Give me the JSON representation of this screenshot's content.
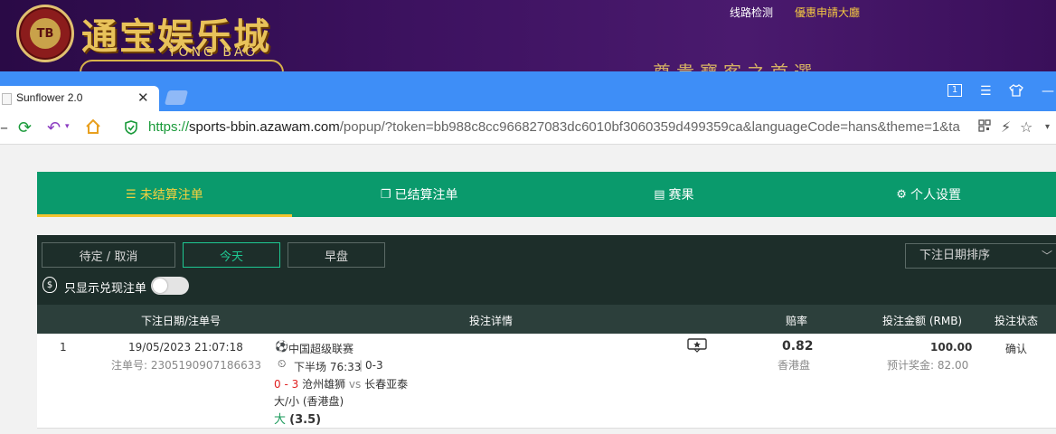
{
  "banner": {
    "chip_text": "TB",
    "brand_cn": "通宝娱乐城",
    "brand_en": "TONG BAO",
    "links": [
      "线路检测",
      "優惠申請大廳"
    ],
    "slogan": "尊貴寶客之首選"
  },
  "browser": {
    "tab_title": "Sunflower 2.0",
    "tab_count": "1",
    "url_scheme": "https://",
    "url_host": "sports-bbin.azawam.com",
    "url_rest": "/popup/?token=bb988c8cc966827083dc6010bf3060359d499359ca&languageCode=hans&theme=1&ta"
  },
  "nav": {
    "tabs": [
      {
        "label": "未结算注单",
        "icon": "unsettled-icon",
        "active": true
      },
      {
        "label": "已结算注单",
        "icon": "settled-icon",
        "active": false
      },
      {
        "label": "赛果",
        "icon": "results-icon",
        "active": false
      },
      {
        "label": "个人设置",
        "icon": "gear-icon",
        "active": false
      }
    ]
  },
  "filters": {
    "buttons": [
      {
        "label": "待定 / 取消",
        "active": false
      },
      {
        "label": "今天",
        "active": true
      },
      {
        "label": "早盘",
        "active": false
      }
    ],
    "sort_label": "下注日期排序",
    "cashout_label": "只显示兑现注单",
    "cashout_on": false
  },
  "table": {
    "headers": {
      "date": "下注日期/注单号",
      "detail": "投注详情",
      "odds": "赔率",
      "amount": "投注金额 (RMB)",
      "status": "投注状态"
    },
    "rows": [
      {
        "index": "1",
        "date": "19/05/2023 21:07:18",
        "bet_no": "注单号: 2305190907186633",
        "league": "中国超级联赛",
        "period": "下半场 76:33",
        "period_score": "0-3",
        "score": "0 - 3",
        "home": "沧州雄狮",
        "vs": "vs",
        "away": "长春亚泰",
        "market": "大/小 (香港盘)",
        "selection": "大",
        "line": "(3.5)",
        "odds": "0.82",
        "odds_type": "香港盘",
        "amount": "100.00",
        "payout": "预计奖金: 82.00",
        "status": "确认"
      }
    ]
  },
  "colors": {
    "nav_green": "#0a9a6c",
    "active_gold": "#f4d03f",
    "filter_bg": "#1d2e2a",
    "browser_blue": "#3e8ef7"
  }
}
